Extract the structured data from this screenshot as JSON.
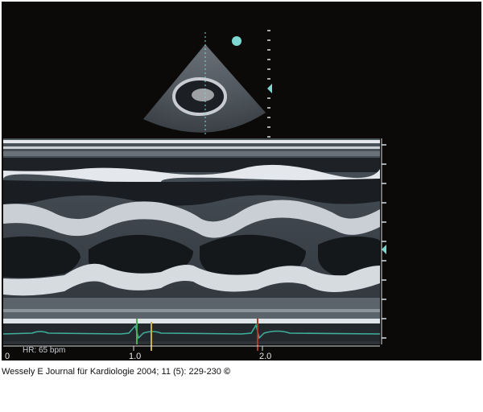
{
  "figure": {
    "heart_rate_label": "HR: 65 bpm",
    "time_ticks": [
      "0",
      "1.0",
      "2.0"
    ],
    "colors": {
      "background": "#0c0a09",
      "tissue_light": "#d8dde3",
      "tissue_mid": "#8a939c",
      "tissue_dark": "#2a2f34",
      "cyan_marker": "#7fd8d0",
      "ecg_trace": "#3fae9a",
      "marker_green": "#4caf50",
      "marker_yellow": "#c8b040",
      "marker_red": "#a83a2a"
    }
  },
  "caption": {
    "text": "Wessely E Journal für Kardiologie 2004; 11 (5): 229-230",
    "symbol": "©"
  }
}
